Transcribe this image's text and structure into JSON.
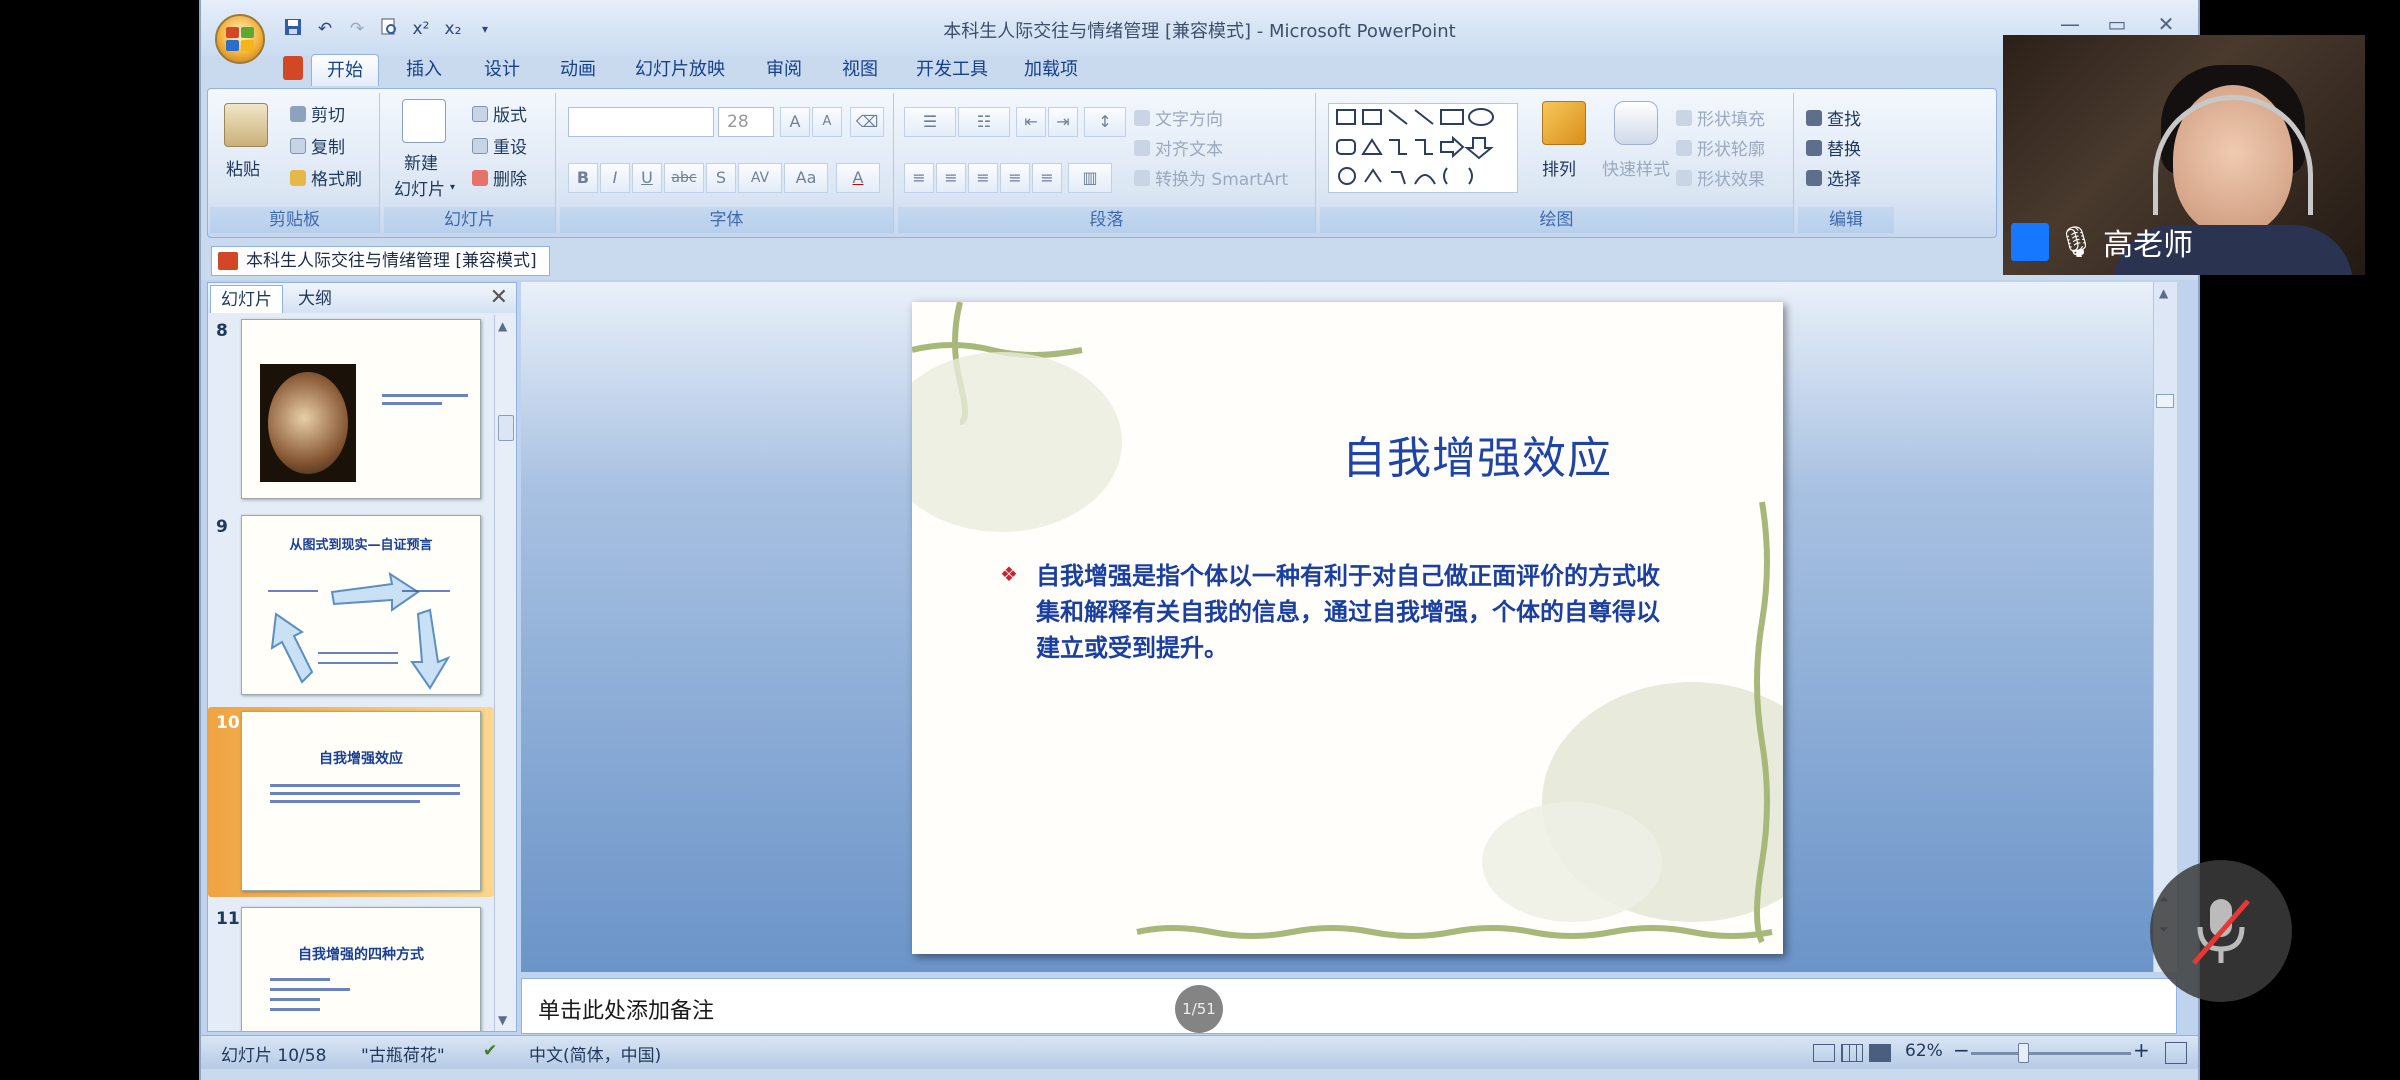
{
  "window": {
    "title": "本科生人际交往与情绪管理 [兼容模式] - Microsoft PowerPoint",
    "minimize": "—",
    "restore": "▭",
    "close": "✕"
  },
  "qat": {
    "save_icon": "save-icon",
    "undo": "↶",
    "redo": "↷",
    "superscript": "x²",
    "subscript": "x₂"
  },
  "tabs": [
    "开始",
    "插入",
    "设计",
    "动画",
    "幻灯片放映",
    "审阅",
    "视图",
    "开发工具",
    "加载项"
  ],
  "active_tab": "开始",
  "ribbon": {
    "clipboard": {
      "paste": "粘贴",
      "cut": "剪切",
      "copy": "复制",
      "format_painter": "格式刷",
      "label": "剪贴板"
    },
    "slides": {
      "new_slide_l1": "新建",
      "new_slide_l2": "幻灯片",
      "layout": "版式",
      "reset": "重设",
      "delete": "删除",
      "label": "幻灯片"
    },
    "font": {
      "font_name": "",
      "font_size": "28",
      "bold": "B",
      "italic": "I",
      "underline": "U",
      "strike": "abc",
      "shadow": "S",
      "spacing": "AV",
      "case": "Aa",
      "color": "A",
      "grow": "A",
      "shrink": "A",
      "label": "字体"
    },
    "paragraph": {
      "text_direction": "文字方向",
      "align_text": "对齐文本",
      "smartart": "转换为 SmartArt",
      "label": "段落"
    },
    "drawing": {
      "arrange": "排列",
      "quick_styles": "快速样式",
      "shape_fill": "形状填充",
      "shape_outline": "形状轮廓",
      "shape_effects": "形状效果",
      "label": "绘图"
    },
    "editing": {
      "find": "查找",
      "replace": "替换",
      "select": "选择",
      "label": "编辑"
    }
  },
  "doc_tab": "本科生人际交往与情绪管理 [兼容模式]",
  "pane": {
    "tab_slides": "幻灯片",
    "tab_outline": "大纲",
    "close": "✕",
    "thumbs": [
      {
        "num": "8"
      },
      {
        "num": "9",
        "title": "从图式到现实—自证预言"
      },
      {
        "num": "10",
        "title": "自我增强效应"
      },
      {
        "num": "11",
        "title": "自我增强的四种方式"
      }
    ]
  },
  "slide": {
    "title": "自我增强效应",
    "bullet_symbol": "❖",
    "body": "自我增强是指个体以一种有利于对自己做正面评价的方式收集和解释有关自我的信息，通过自我增强，个体的自尊得以建立或受到提升。"
  },
  "notes_placeholder": "单击此处添加备注",
  "page_indicator": "1/51",
  "status": {
    "slide_pos": "幻灯片 10/58",
    "theme": "\"古瓶荷花\"",
    "language": "中文(简体，中国)",
    "zoom": "62%",
    "zoom_out": "−",
    "zoom_in": "+"
  },
  "camera": {
    "name": "高老师",
    "mic_icon": "🎙"
  },
  "colors": {
    "accent": "#1f44a8",
    "ribbon_label": "#3e6aaa",
    "selected_thumb": "#f0a341"
  }
}
